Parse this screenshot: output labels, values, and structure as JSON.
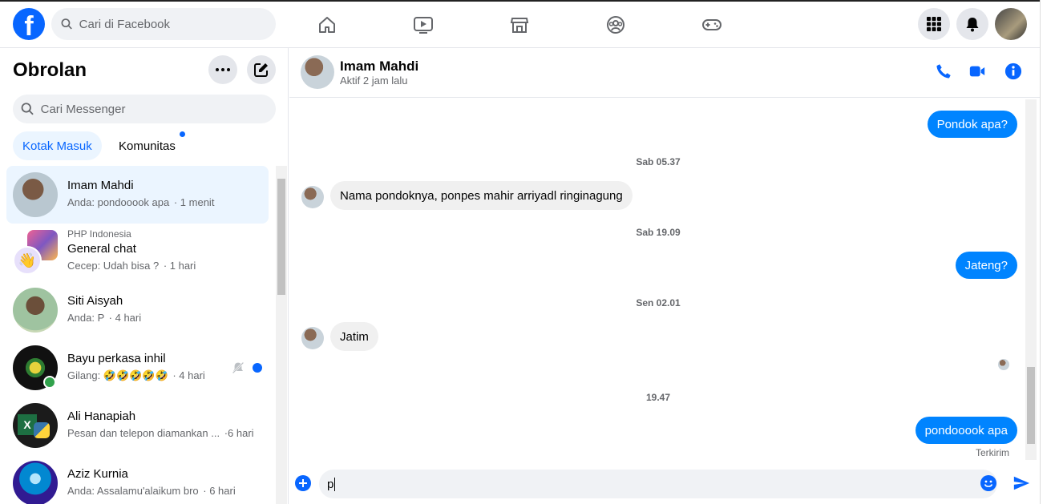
{
  "topbar": {
    "logo": "f",
    "search_placeholder": "Cari di Facebook",
    "nav_icons": [
      "home-icon",
      "video-icon",
      "marketplace-icon",
      "groups-icon",
      "gaming-icon"
    ]
  },
  "sidebar": {
    "title": "Obrolan",
    "search_placeholder": "Cari Messenger",
    "tabs": [
      "Kotak Masuk",
      "Komunitas"
    ],
    "conversations": [
      {
        "name": "Imam Mahdi",
        "preview": "Anda: pondooook apa",
        "time": "· 1 menit"
      },
      {
        "group": "PHP Indonesia",
        "name": "General chat",
        "preview": "Cecep: Udah bisa ?",
        "time": "· 1 hari"
      },
      {
        "name": "Siti Aisyah",
        "preview": "Anda: P",
        "time": "· 4 hari"
      },
      {
        "name": "Bayu perkasa inhil",
        "preview": "Gilang: 🤣🤣🤣🤣🤣",
        "time": "· 4 hari"
      },
      {
        "name": "Ali Hanapiah",
        "preview": "Pesan dan telepon diamankan ...",
        "time": "·6 hari"
      },
      {
        "name": "Aziz Kurnia",
        "preview": "Anda: Assalamu'alaikum bro",
        "time": "· 6 hari"
      }
    ]
  },
  "chat": {
    "name": "Imam Mahdi",
    "status": "Aktif 2 jam lalu",
    "messages": {
      "m1": "Pondok apa?",
      "t1": "Sab 05.37",
      "m2": "Nama pondoknya, ponpes mahir arriyadl ringinagung",
      "t2": "Sab 19.09",
      "m3": "Jateng?",
      "t3": "Sen 02.01",
      "m4": "Jatim",
      "t4": "19.47",
      "m5": "pondooook apa",
      "sent": "Terkirim"
    },
    "composer_text": "p"
  },
  "colors": {
    "brand": "#0866ff",
    "bubble_out": "#0084ff",
    "bubble_in": "#f0f0f0"
  }
}
